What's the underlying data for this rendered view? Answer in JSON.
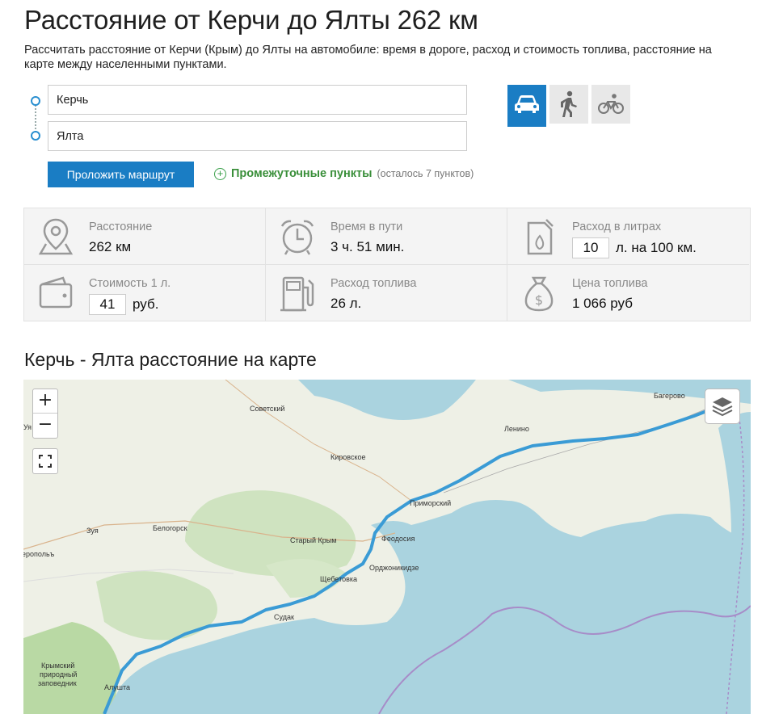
{
  "page": {
    "title": "Расстояние от Керчи до Ялты 262 км",
    "subtitle": "Рассчитать расстояние от Керчи (Крым) до Ялты на автомобиле: время в дороге, расход и стоимость топлива, расстояние на карте между населенными пунктами."
  },
  "route": {
    "from": "Керчь",
    "to": "Ялта",
    "build_label": "Проложить маршрут",
    "waypoints_label": "Промежуточные пункты",
    "waypoints_note": "(осталось 7 пунктов)",
    "modes": [
      "car-icon",
      "walk-icon",
      "bike-icon"
    ],
    "active_mode": "car"
  },
  "stats": {
    "distance": {
      "label": "Расстояние",
      "value": "262 км"
    },
    "time": {
      "label": "Время в пути",
      "value": "3 ч. 51 мин."
    },
    "consumption": {
      "label": "Расход в литрах",
      "input": "10",
      "unit": "л. на 100 км."
    },
    "cost_per_liter": {
      "label": "Стоимость 1 л.",
      "input": "41",
      "unit": "руб."
    },
    "fuel": {
      "label": "Расход топлива",
      "value": "26 л."
    },
    "fuel_price": {
      "label": "Цена топлива",
      "value": "1 066 руб"
    }
  },
  "map": {
    "heading": "Керчь - Ялта расстояние на карте",
    "zoom_in": "+",
    "zoom_out": "−",
    "labels": {
      "bagerovo": "Багерово",
      "sovetsky": "Советский",
      "lenino": "Ленино",
      "kirovskoe": "Кировское",
      "primorsky": "Приморский",
      "zuya": "Зуя",
      "belogorsk": "Белогорск",
      "stary_krym": "Старый Крым",
      "feodosia": "Феодосия",
      "ordzhonikidze": "Орджоникидзе",
      "simferopol": "еропольъ",
      "shchebetovka": "Щебетовка",
      "sudak": "Судак",
      "reserve1": "Крымский",
      "reserve2": "природный",
      "reserve3": "заповедник",
      "alushta": "Алушта",
      "edge": "Уя"
    },
    "colors": {
      "route": "#3a9bd5",
      "sea": "#aad3df",
      "land": "#eef0e6",
      "forest": "#c8e0b8",
      "border": "#a78cc8"
    }
  }
}
